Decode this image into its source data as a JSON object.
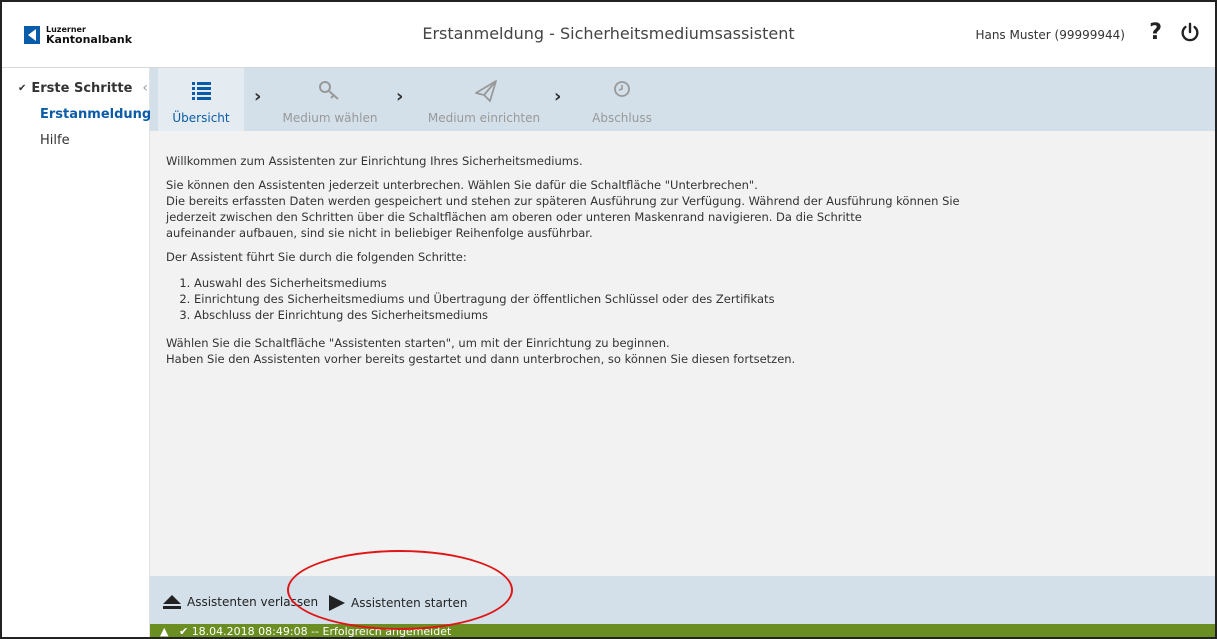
{
  "header": {
    "logo_top": "Luzerner",
    "logo_bottom": "Kantonalbank",
    "title": "Erstanmeldung - Sicherheitsmediumsassistent",
    "user": "Hans Muster (99999944)",
    "help_glyph": "?",
    "help_icon": "question-icon",
    "power_icon": "power-icon"
  },
  "sidebar": {
    "group": "Erste Schritte",
    "items": [
      {
        "label": "Erstanmeldung",
        "active": true
      },
      {
        "label": "Hilfe",
        "active": false
      }
    ]
  },
  "steps": [
    {
      "label": "Übersicht",
      "icon": "list-icon",
      "active": true
    },
    {
      "label": "Medium wählen",
      "icon": "key-icon",
      "active": false
    },
    {
      "label": "Medium einrichten",
      "icon": "paper-plane-icon",
      "active": false
    },
    {
      "label": "Abschluss",
      "icon": "clock-icon",
      "active": false
    }
  ],
  "content": {
    "p1": "Willkommen zum Assistenten zur Einrichtung Ihres Sicherheitsmediums.",
    "p2_line1": "Sie können den Assistenten jederzeit unterbrechen. Wählen Sie dafür die Schaltfläche \"Unterbrechen\".",
    "p2_line2": "Die bereits erfassten Daten werden gespeichert und stehen zur späteren Ausführung zur Verfügung. Während der Ausführung können Sie",
    "p2_line3": "jederzeit zwischen den Schritten über die Schaltflächen am oberen oder unteren Maskenrand navigieren. Da die Schritte",
    "p2_line4": "aufeinander aufbauen, sind sie nicht in beliebiger Reihenfolge ausführbar.",
    "p3": "Der Assistent führt Sie durch die folgenden Schritte:",
    "list": [
      "Auswahl des Sicherheitsmediums",
      "Einrichtung des Sicherheitsmediums und Übertragung der öffentlichen Schlüssel oder des Zertifikats",
      "Abschluss der Einrichtung des Sicherheitsmediums"
    ],
    "p4_line1": "Wählen Sie die Schaltfläche \"Assistenten starten\", um mit der Einrichtung zu beginnen.",
    "p4_line2": "Haben Sie den Assistenten vorher bereits gestartet und dann unterbrochen, so können Sie diesen fortsetzen."
  },
  "footer": {
    "leave_label": "Assistenten verlassen",
    "start_label": "Assistenten starten"
  },
  "status": {
    "text": "18.04.2018 08:49:08 -- Erfolgreich angemeldet"
  },
  "colors": {
    "accent": "#0a5ca8",
    "step_bar": "#d3e0ea",
    "status_bar": "#6b8e23",
    "highlight": "#e01616"
  }
}
